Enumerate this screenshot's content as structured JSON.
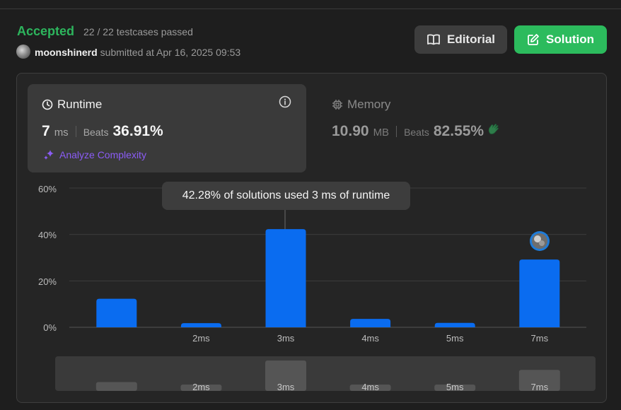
{
  "header": {
    "status": "Accepted",
    "testcases": "22 / 22 testcases passed",
    "username": "moonshinerd",
    "submitted_text": "submitted at Apr 16, 2025 09:53",
    "editorial_label": "Editorial",
    "solution_label": "Solution"
  },
  "runtime": {
    "title": "Runtime",
    "value": "7",
    "unit": "ms",
    "beats_label": "Beats",
    "beats": "36.91%",
    "analyze_label": "Analyze Complexity"
  },
  "memory": {
    "title": "Memory",
    "value": "10.90",
    "unit": "MB",
    "beats_label": "Beats",
    "beats": "82.55%"
  },
  "tooltip": "42.28% of solutions used 3 ms of runtime",
  "colors": {
    "accepted": "#2db55d",
    "solution_button": "#2cbb5d",
    "bar": "#0a6cf0",
    "analyze": "#8b5cf6",
    "clap": "#2db55d"
  },
  "icons": {
    "runtime": "clock-icon",
    "memory": "chip-icon",
    "info": "info-icon",
    "editorial": "book-icon",
    "solution": "edit-icon",
    "analyze": "sparkle-icon",
    "memory_beats": "clap-icon"
  },
  "chart_data": {
    "type": "bar",
    "categories": [
      "",
      "2ms",
      "3ms",
      "4ms",
      "5ms",
      "7ms"
    ],
    "values": [
      12.3,
      1.8,
      42.28,
      3.6,
      1.9,
      29.2
    ],
    "y_ticks": [
      "60%",
      "40%",
      "20%",
      "0%"
    ],
    "ylim": [
      0,
      60
    ],
    "grid": true,
    "highlight_category": "7ms",
    "overview_values": [
      12.3,
      1.8,
      42.28,
      3.6,
      1.9,
      29.2
    ]
  }
}
